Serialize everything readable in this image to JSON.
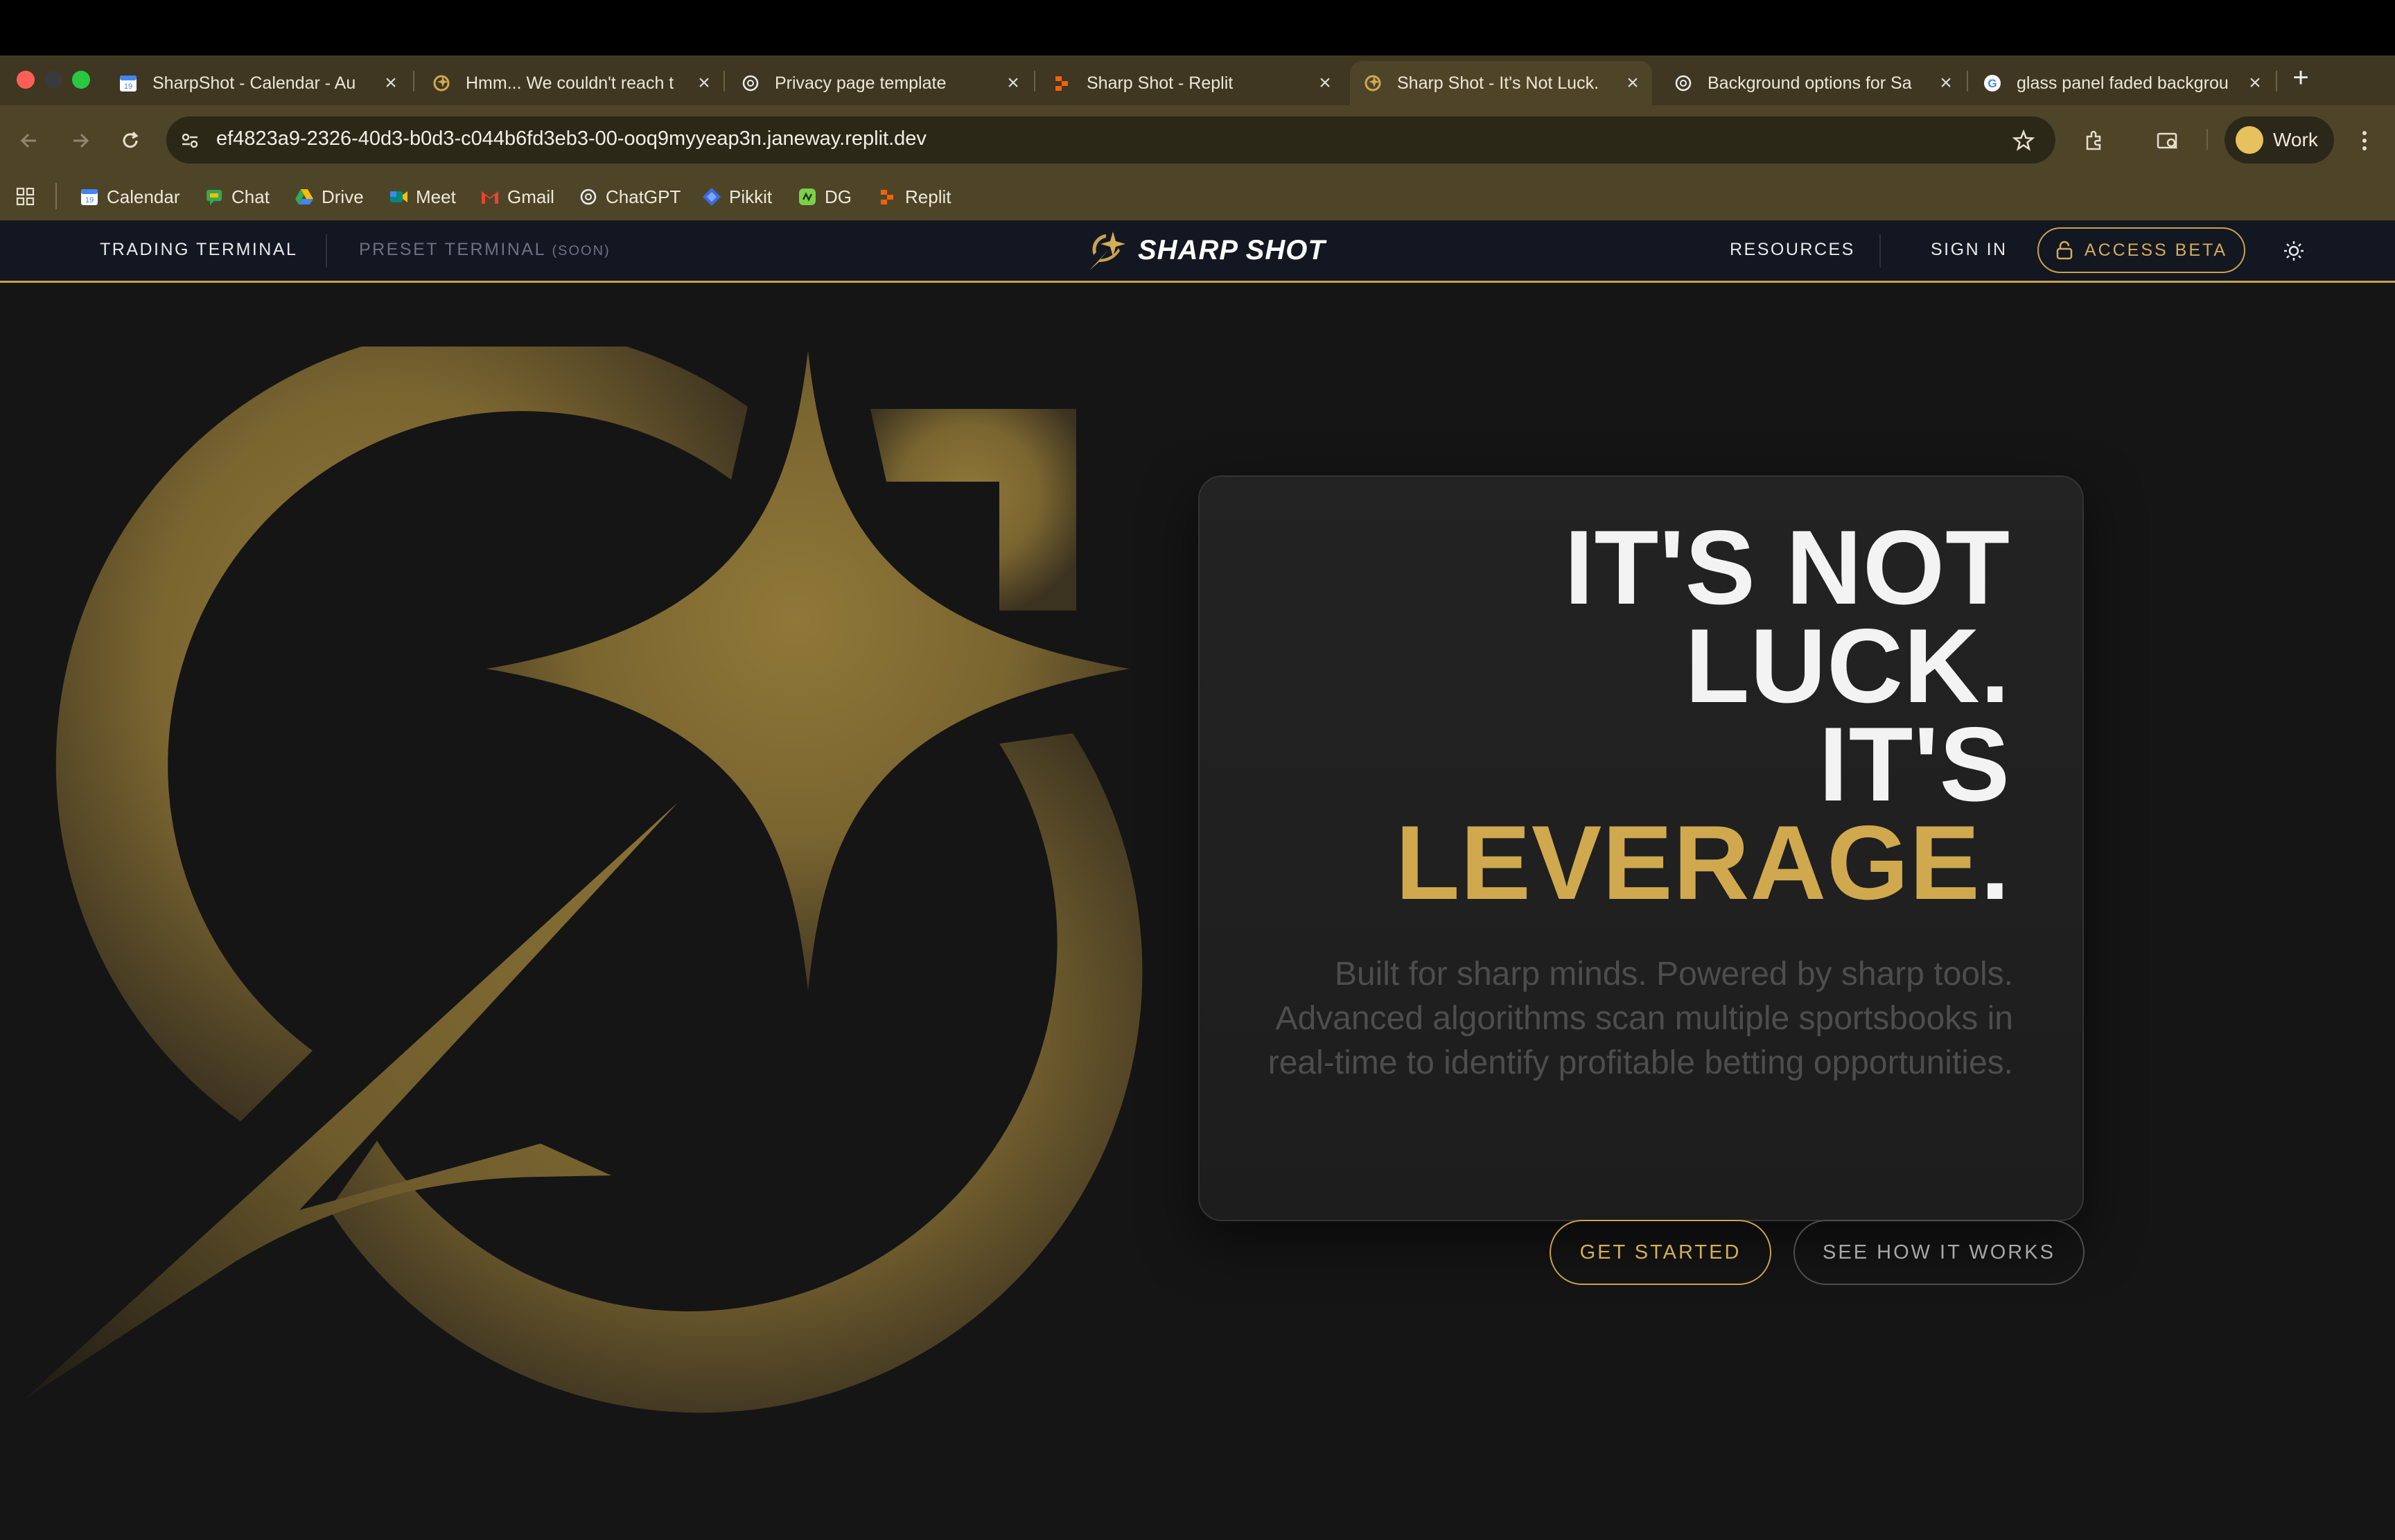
{
  "browser": {
    "tabs": [
      {
        "title": "SharpShot - Calendar - Au",
        "icon": "calendar-icon",
        "active": false
      },
      {
        "title": "Hmm... We couldn't reach t",
        "icon": "sharpshot-favicon",
        "active": false
      },
      {
        "title": "Privacy page template",
        "icon": "openai-icon",
        "active": false
      },
      {
        "title": "Sharp Shot - Replit",
        "icon": "replit-icon",
        "active": false
      },
      {
        "title": "Sharp Shot - It's Not Luck.",
        "icon": "sharpshot-favicon",
        "active": true
      },
      {
        "title": "Background options for Sa",
        "icon": "openai-icon",
        "active": false
      },
      {
        "title": "glass panel faded backgrou",
        "icon": "google-icon",
        "active": false
      }
    ],
    "url": "ef4823a9-2326-40d3-b0d3-c044b6fd3eb3-00-ooq9myyeap3n.janeway.replit.dev",
    "profile_label": "Work",
    "bookmarks": [
      {
        "label": "Calendar",
        "icon": "calendar-icon"
      },
      {
        "label": "Chat",
        "icon": "chat-icon"
      },
      {
        "label": "Drive",
        "icon": "drive-icon"
      },
      {
        "label": "Meet",
        "icon": "meet-icon"
      },
      {
        "label": "Gmail",
        "icon": "gmail-icon"
      },
      {
        "label": "ChatGPT",
        "icon": "openai-icon"
      },
      {
        "label": "Pikkit",
        "icon": "pikkit-icon"
      },
      {
        "label": "DG",
        "icon": "dg-icon"
      },
      {
        "label": "Replit",
        "icon": "replit-icon"
      }
    ]
  },
  "site": {
    "nav": {
      "trading_terminal": "TRADING TERMINAL",
      "preset_terminal": "PRESET TERMINAL",
      "preset_soon": "(SOON)",
      "resources": "RESOURCES",
      "sign_in": "SIGN IN",
      "access_beta": "ACCESS BETA"
    },
    "logo_text": "SHARP SHOT",
    "hero": {
      "headline_line1": "IT'S NOT",
      "headline_line2": "LUCK.",
      "headline_line3": "IT'S",
      "headline_highlight": "LEVERAGE",
      "headline_period": ".",
      "subtext": "Built for sharp minds. Powered by sharp tools. Advanced algorithms scan multiple sportsbooks in real-time to identify profitable betting opportunities.",
      "cta_primary": "GET STARTED",
      "cta_secondary": "SEE HOW IT WORKS"
    }
  },
  "colors": {
    "accent_gold": "#c7a24b",
    "page_background": "#151515",
    "header_background": "#131722",
    "browser_chrome": "#4e4529"
  }
}
